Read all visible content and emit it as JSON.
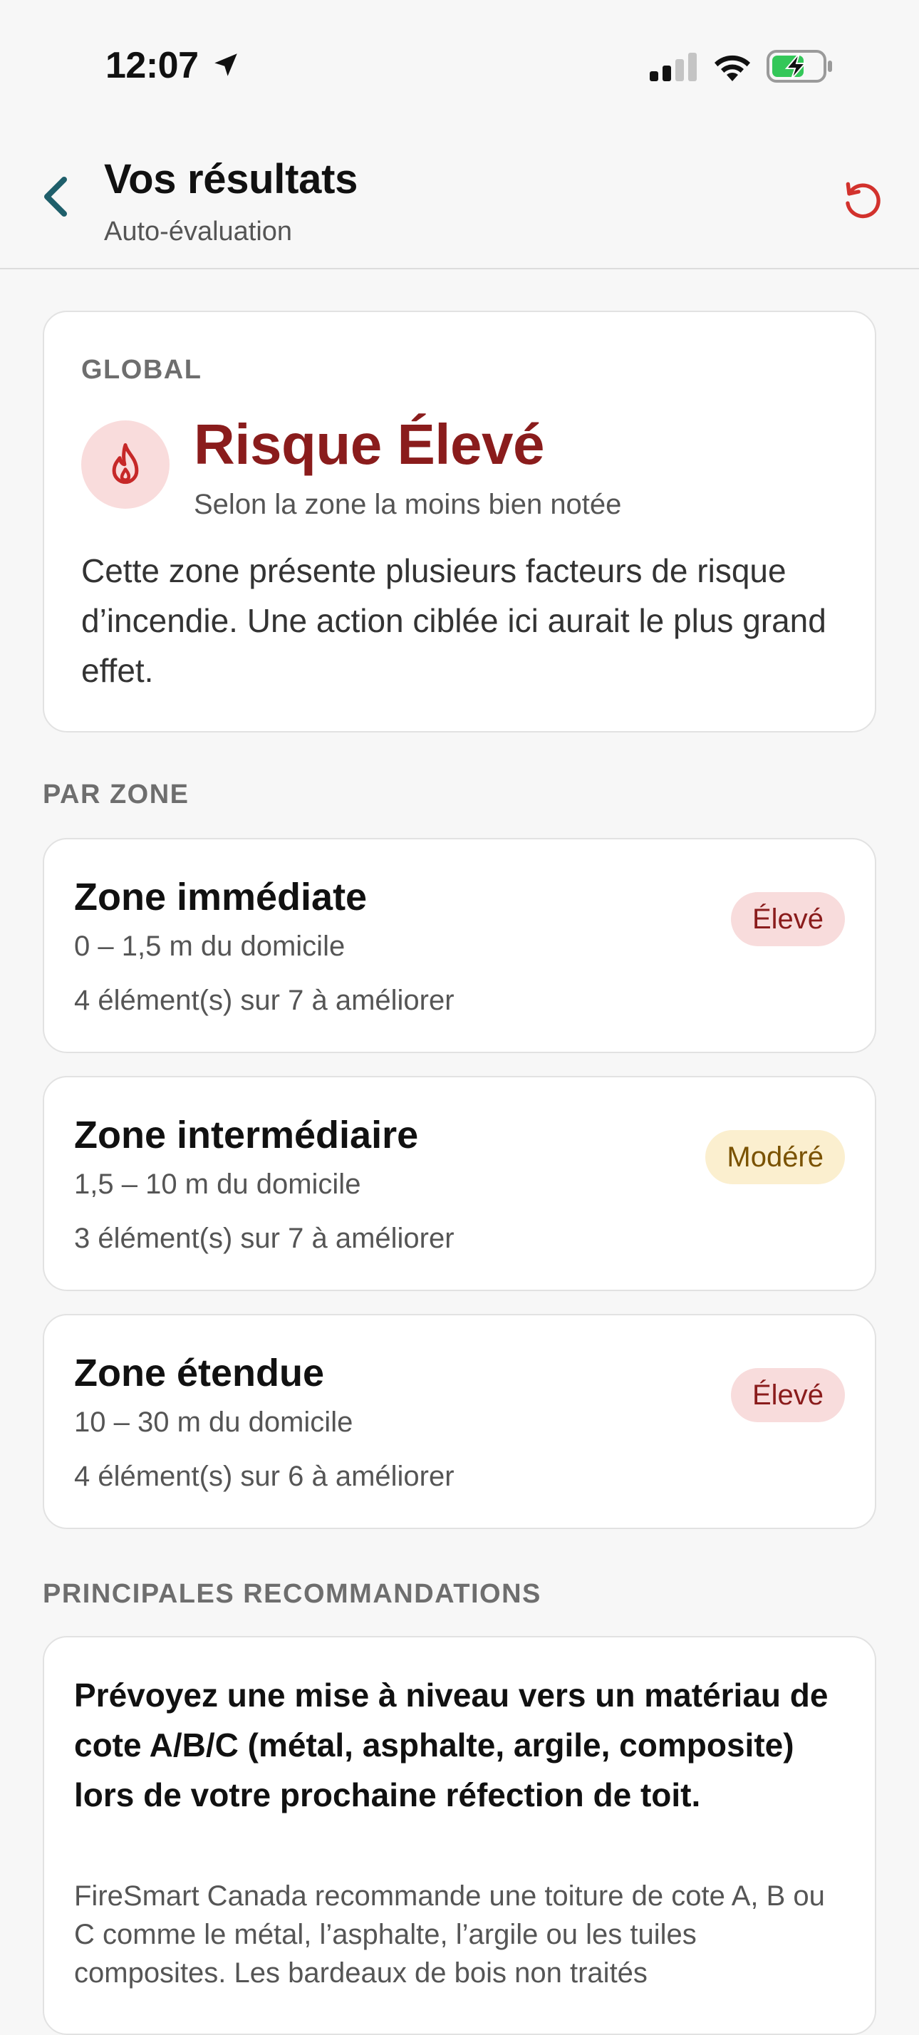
{
  "status_bar": {
    "time": "12:07",
    "icons": [
      "location-arrow-icon",
      "signal-icon",
      "wifi-icon",
      "battery-charging-icon"
    ]
  },
  "header": {
    "title": "Vos résultats",
    "subtitle": "Auto-évaluation",
    "back_icon": "chevron-left-icon",
    "reset_icon": "refresh-icon"
  },
  "global": {
    "label": "GLOBAL",
    "icon": "flame-icon",
    "risk_title": "Risque Élevé",
    "risk_subtitle": "Selon la zone la moins bien notée",
    "description": "Cette zone présente plusieurs facteurs de risque d’incendie. Une action ciblée ici aurait le plus grand effet."
  },
  "zones_section": {
    "label": "PAR ZONE",
    "zones": [
      {
        "title": "Zone immédiate",
        "range": "0 – 1,5 m du domicile",
        "count": "4 élément(s) sur 7 à améliorer",
        "badge": "Élevé",
        "level": "high"
      },
      {
        "title": "Zone intermédiaire",
        "range": "1,5 – 10 m du domicile",
        "count": "3 élément(s) sur 7 à améliorer",
        "badge": "Modéré",
        "level": "moderate"
      },
      {
        "title": "Zone étendue",
        "range": "10 – 30 m du domicile",
        "count": "4 élément(s) sur 6 à améliorer",
        "badge": "Élevé",
        "level": "high"
      }
    ]
  },
  "recommendations": {
    "label": "PRINCIPALES RECOMMANDATIONS",
    "items": [
      {
        "title": "Prévoyez une mise à niveau vers un matériau de cote A/B/C (métal, asphalte, argile, composite) lors de votre prochaine réfection de toit.",
        "body": "FireSmart Canada recommande une toiture de cote A, B ou C comme le métal, l’asphalte, l’argile ou les tuiles composites. Les bardeaux de bois non traités"
      }
    ]
  },
  "colors": {
    "high_text": "#8a1c1c",
    "high_bg": "#f8dcdc",
    "moderate_text": "#7a5200",
    "moderate_bg": "#fbefcf",
    "accent_teal": "#1f5f6b",
    "reset_red": "#d2322d"
  }
}
